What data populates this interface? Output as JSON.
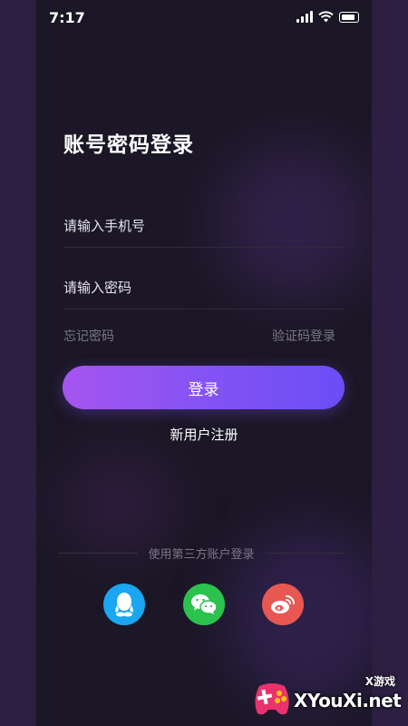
{
  "status_bar": {
    "time": "7:17"
  },
  "login": {
    "title": "账号密码登录",
    "phone_placeholder": "请输入手机号",
    "password_placeholder": "请输入密码",
    "forgot_password": "忘记密码",
    "code_login": "验证码登录",
    "login_button": "登录",
    "register": "新用户注册"
  },
  "third_party": {
    "label": "使用第三方账户登录",
    "providers": [
      {
        "name": "qq-icon",
        "color": "#1aa6f0"
      },
      {
        "name": "wechat-icon",
        "color": "#2bc24e"
      },
      {
        "name": "weibo-icon",
        "color": "#e85752"
      }
    ]
  },
  "watermark": {
    "small": "X游戏",
    "brand": "XYouXi.net"
  },
  "colors": {
    "background": "#1b1726",
    "accent_start": "#a555f0",
    "accent_end": "#6a4ef6"
  }
}
